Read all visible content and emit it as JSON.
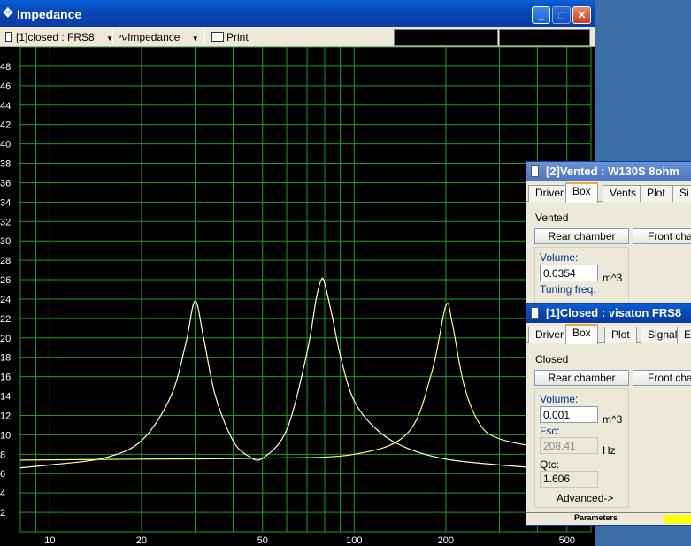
{
  "main_window": {
    "title": "Impedance",
    "toolbar": {
      "project_select": "[1]closed : FRS8",
      "graph_select": "Impedance",
      "print_label": "Print"
    }
  },
  "chart_data": {
    "type": "line",
    "xscale": "log",
    "xlim": [
      8,
      600
    ],
    "ylim": [
      0,
      50
    ],
    "x_tick_labels": [
      "10",
      "20",
      "50",
      "100",
      "200",
      "500"
    ],
    "y_tick_labels": [
      "2",
      "4",
      "6",
      "8",
      "10",
      "12",
      "14",
      "16",
      "18",
      "20",
      "22",
      "24",
      "26",
      "28",
      "30",
      "32",
      "34",
      "36",
      "38",
      "40",
      "42",
      "44",
      "46",
      "48"
    ],
    "grid": true,
    "series": [
      {
        "color": "#ffffcc",
        "x": [
          8,
          10,
          15,
          20,
          25,
          28,
          30,
          32,
          35,
          40,
          45,
          50,
          60,
          70,
          75,
          78,
          80,
          85,
          90,
          100,
          120,
          150,
          200,
          300,
          400,
          600
        ],
        "y": [
          6.6,
          6.9,
          7.6,
          9.4,
          14.0,
          19.5,
          23.8,
          20.0,
          14.0,
          9.4,
          7.8,
          7.6,
          10.5,
          18.5,
          24.0,
          26.0,
          25.6,
          22.0,
          18.2,
          13.5,
          10.4,
          8.6,
          7.5,
          6.9,
          6.6,
          6.3
        ]
      },
      {
        "color": "#ffff66",
        "x": [
          8,
          20,
          50,
          100,
          150,
          180,
          200,
          210,
          230,
          260,
          300,
          400,
          600
        ],
        "y": [
          7.4,
          7.5,
          7.6,
          8.0,
          10.2,
          16.5,
          23.3,
          21.5,
          15.0,
          11.0,
          9.6,
          8.8,
          8.4
        ]
      }
    ]
  },
  "vented_window": {
    "title": "[2]Vented : W130S 8ohm",
    "tabs": [
      "Driver",
      "Box",
      "Vents",
      "Plot",
      "Si"
    ],
    "box_type": "Vented",
    "rear_chamber_label": "Rear chamber",
    "front_chamber_label": "Front chan",
    "volume_label": "Volume:",
    "volume_value": "0.0354",
    "volume_unit": "m^3",
    "tuning_label": "Tuning freq."
  },
  "closed_window": {
    "title": "[1]Closed : visaton FRS8",
    "tabs": [
      "Driver",
      "Box",
      "Plot",
      "Signal",
      "Et"
    ],
    "box_type": "Closed",
    "rear_chamber_label": "Rear chamber",
    "front_chamber_label": "Front chan",
    "volume_label": "Volume:",
    "volume_value": "0.001",
    "volume_unit": "m^3",
    "fsc_label": "Fsc:",
    "fsc_value": "208.41",
    "fsc_unit": "Hz",
    "qtc_label": "Qtc:",
    "qtc_value": "1.606",
    "advanced_label": "Advanced->",
    "status_label": "Parameters"
  }
}
